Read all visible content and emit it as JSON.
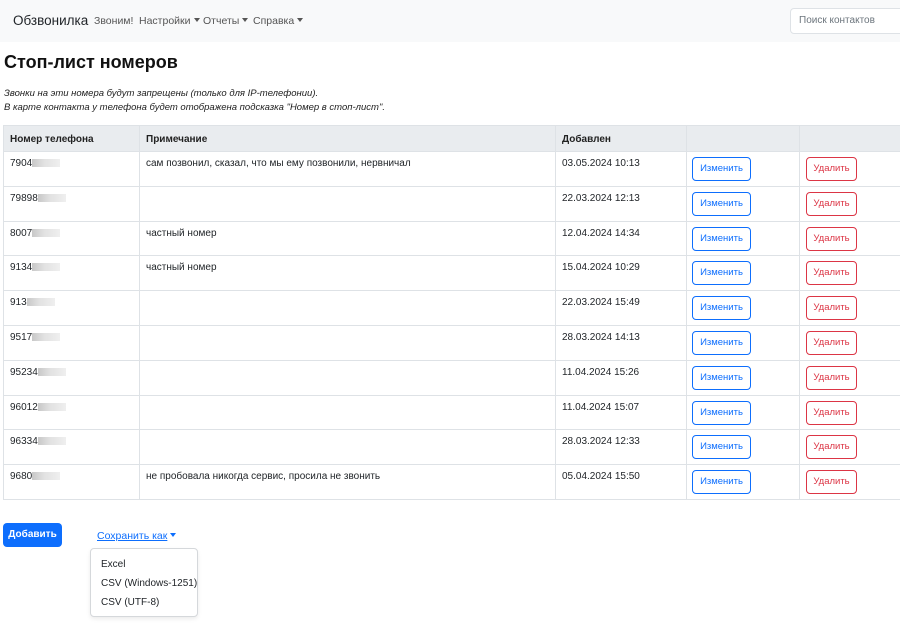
{
  "navbar": {
    "brand": "Обзвонилка",
    "items": [
      {
        "label": "Звоним!",
        "dropdown": false
      },
      {
        "label": "Настройки",
        "dropdown": true
      },
      {
        "label": "Отчеты",
        "dropdown": true
      },
      {
        "label": "Справка",
        "dropdown": true
      }
    ],
    "search_placeholder": "Поиск контактов"
  },
  "page": {
    "title": "Стоп-лист номеров",
    "notes": [
      "Звонки на эти номера будут запрещены (только для IP-телефонии).",
      "В карте контакта у телефона будет отображена подсказка \"Номер в стоп-лист\"."
    ]
  },
  "table": {
    "headers": [
      "Номер телефона",
      "Примечание",
      "Добавлен",
      "",
      ""
    ],
    "edit_label": "Изменить",
    "delete_label": "Удалить",
    "rows": [
      {
        "phone": "7904",
        "note": "сам позвонил, сказал, что мы ему позвонили, нервничал",
        "added": "03.05.2024 10:13"
      },
      {
        "phone": "79898",
        "note": "",
        "added": "22.03.2024 12:13"
      },
      {
        "phone": "8007",
        "note": "частный номер",
        "added": "12.04.2024 14:34"
      },
      {
        "phone": "9134",
        "note": "частный номер",
        "added": "15.04.2024 10:29"
      },
      {
        "phone": "913",
        "note": "",
        "added": "22.03.2024 15:49"
      },
      {
        "phone": "9517",
        "note": "",
        "added": "28.03.2024 14:13"
      },
      {
        "phone": "95234",
        "note": "",
        "added": "11.04.2024 15:26"
      },
      {
        "phone": "96012",
        "note": "",
        "added": "11.04.2024 15:07"
      },
      {
        "phone": "96334",
        "note": "",
        "added": "28.03.2024 12:33"
      },
      {
        "phone": "9680",
        "note": "не пробовала никогда сервис, просила не звонить",
        "added": "05.04.2024 15:50"
      }
    ]
  },
  "footer": {
    "add_label": "Добавить",
    "save_as_label": "Сохранить как",
    "save_options": [
      "Excel",
      "CSV (Windows-1251)",
      "CSV (UTF-8)"
    ]
  },
  "colors": {
    "primary": "#0d6efd",
    "danger": "#dc3545",
    "navbar_bg": "#f8f9fa",
    "table_header_bg": "#e9ecef"
  }
}
